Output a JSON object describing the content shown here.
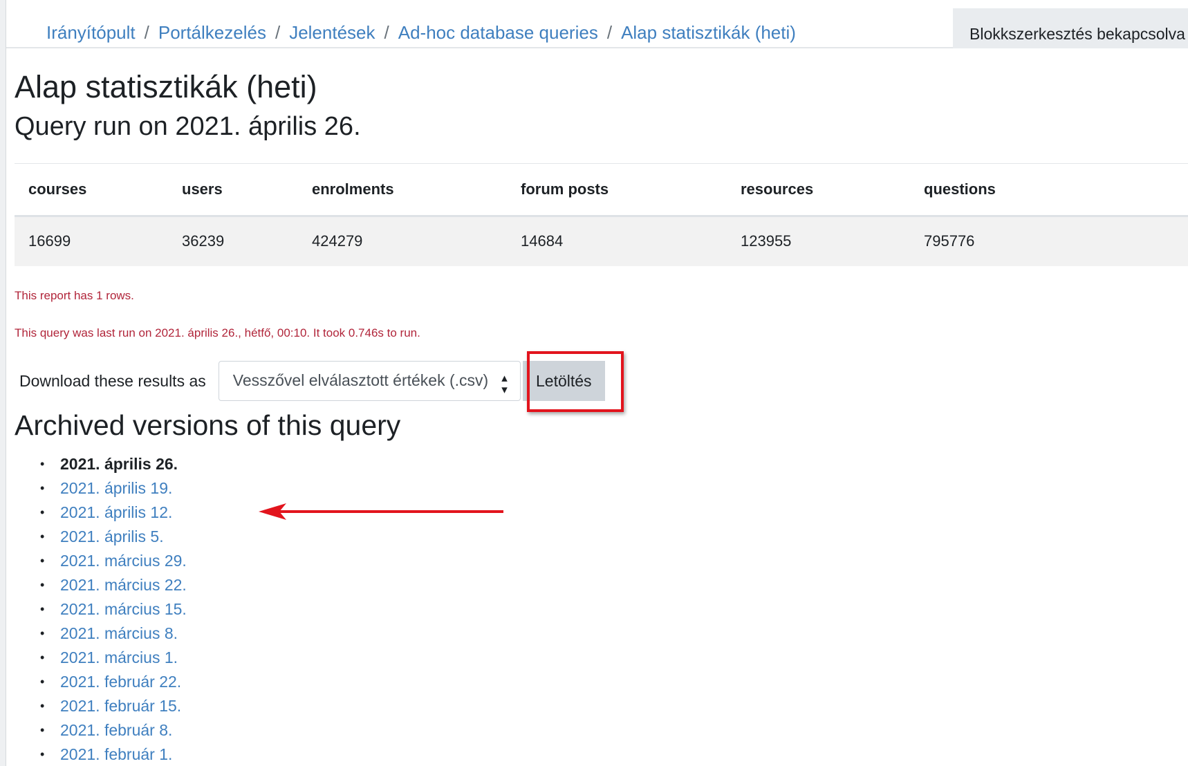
{
  "breadcrumb": [
    "Irányítópult",
    "Portálkezelés",
    "Jelentések",
    "Ad-hoc database queries",
    "Alap statisztikák (heti)"
  ],
  "breadcrumb_separator": "/",
  "header": {
    "editing_button": "Blokkszerkesztés bekapcsolva"
  },
  "page": {
    "title": "Alap statisztikák (heti)",
    "subtitle": "Query run on 2021. április 26."
  },
  "table": {
    "columns": [
      "courses",
      "users",
      "enrolments",
      "forum posts",
      "resources",
      "questions"
    ],
    "rows": [
      [
        "16699",
        "36239",
        "424279",
        "14684",
        "123955",
        "795776"
      ]
    ]
  },
  "notes": {
    "row_count": "This report has 1 rows.",
    "last_run": "This query was last run on 2021. április 26., hétfő, 00:10. It took 0.746s to run."
  },
  "download": {
    "label": "Download these results as",
    "format_selected": "Vesszővel elválasztott értékek (.csv)",
    "button": "Letöltés"
  },
  "archive": {
    "title": "Archived versions of this query",
    "current": "2021. április 26.",
    "versions": [
      "2021. április 19.",
      "2021. április 12.",
      "2021. április 5.",
      "2021. március 29.",
      "2021. március 22.",
      "2021. március 15.",
      "2021. március 8.",
      "2021. március 1.",
      "2021. február 22.",
      "2021. február 15.",
      "2021. február 8.",
      "2021. február 1."
    ]
  },
  "colors": {
    "link": "#3f7fbf",
    "note_text": "#b1253a",
    "annotation": "#e2141d"
  }
}
